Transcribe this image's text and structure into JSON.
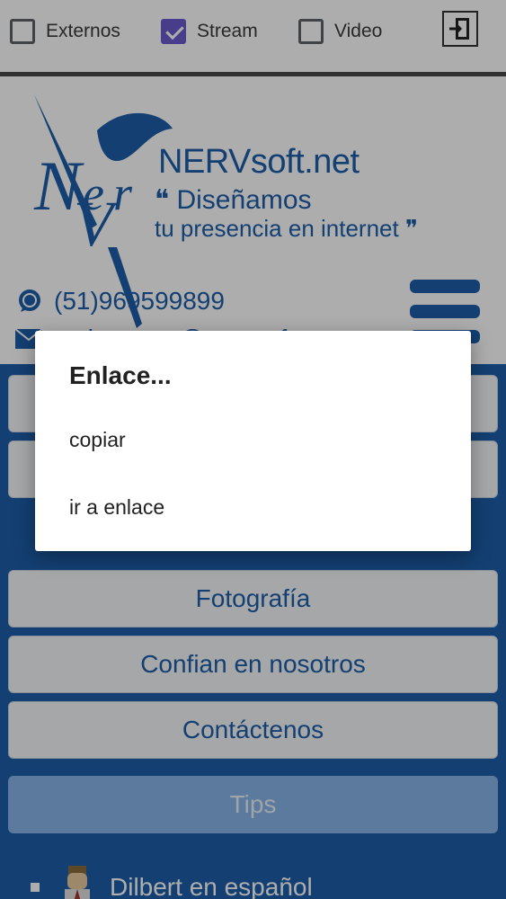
{
  "toolbar": {
    "options": [
      {
        "label": "Externos",
        "checked": false
      },
      {
        "label": "Stream",
        "checked": true
      },
      {
        "label": "Video",
        "checked": false
      }
    ],
    "exit_icon": "exit-door-icon"
  },
  "header": {
    "site_name": "NERVsoft.net",
    "slogan_line1": "❝ Diseñamos",
    "slogan_line2": "tu presencia en internet ❞",
    "phone": "(51)969599899",
    "email": "webmaster@nervsoft.net",
    "phone_icon": "whatsapp-icon",
    "email_icon": "envelope-icon",
    "menu_icon": "hamburger-menu-icon"
  },
  "menu": {
    "items": [
      "",
      "",
      "Fotografía",
      "Confian en nosotros",
      "Contáctenos",
      "Tips"
    ],
    "external_link": "Dilbert en español"
  },
  "dialog": {
    "title": "Enlace...",
    "options": [
      "copiar",
      "ir a enlace"
    ]
  },
  "colors": {
    "brand": "#1d5da8",
    "checkbox_accent": "#6a5acd",
    "tips_button": "#86b4e7"
  }
}
